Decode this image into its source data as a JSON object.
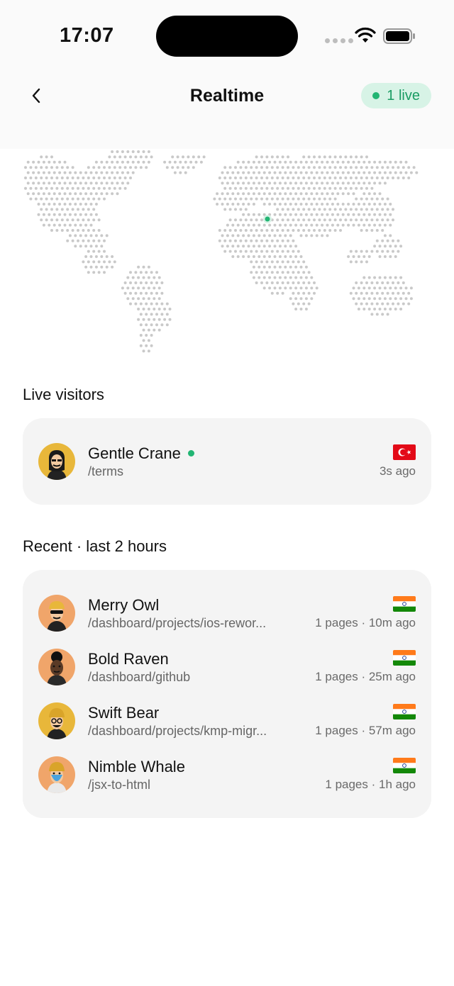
{
  "status_bar": {
    "time": "17:07"
  },
  "header": {
    "title": "Realtime",
    "live_badge": "1 live",
    "back_icon": "chevron-left-icon"
  },
  "map": {
    "highlight_country": "Turkey",
    "highlight_color": "#22b573",
    "dot_color": "#c9c9c9"
  },
  "live_section": {
    "title": "Live visitors",
    "visitors": [
      {
        "name": "Gentle Crane",
        "path": "/terms",
        "time": "3s ago",
        "flag": "Turkey",
        "online": true
      }
    ]
  },
  "recent_section": {
    "title": "Recent · last 2 hours",
    "visitors": [
      {
        "name": "Merry Owl",
        "path": "/dashboard/projects/ios-rewor...",
        "meta": "1 pages · 10m ago",
        "flag": "India"
      },
      {
        "name": "Bold Raven",
        "path": "/dashboard/github",
        "meta": "1 pages · 25m ago",
        "flag": "India"
      },
      {
        "name": "Swift Bear",
        "path": "/dashboard/projects/kmp-migr...",
        "meta": "1 pages · 57m ago",
        "flag": "India"
      },
      {
        "name": "Nimble Whale",
        "path": "/jsx-to-html",
        "meta": "1 pages · 1h ago",
        "flag": "India"
      }
    ]
  },
  "colors": {
    "accent_green": "#22b573",
    "pill_bg": "#d7f3e6",
    "card_bg": "#f4f4f4"
  }
}
